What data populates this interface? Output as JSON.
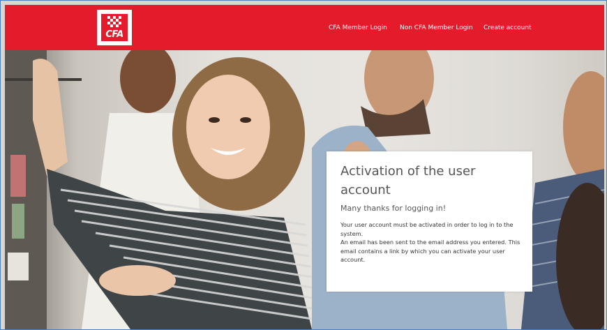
{
  "header": {
    "logo_text": "CFA",
    "nav": [
      {
        "label": "CFA Member Login"
      },
      {
        "label": "Non CFA Member Login"
      },
      {
        "label": "Create account"
      }
    ]
  },
  "card": {
    "title": "Activation of the user account",
    "subtitle": "Many thanks for logging in!",
    "paragraphs": [
      "Your user account must be activated in order to log in to the system.",
      "An email has been sent to the email address you entered. This email contains a link by which you can activate your user account."
    ]
  },
  "colors": {
    "brand_red": "#e31b2b",
    "card_bg": "#ffffff",
    "title_text": "#555555"
  }
}
